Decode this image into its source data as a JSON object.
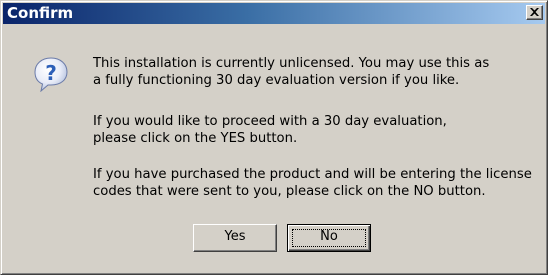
{
  "window": {
    "title": "Confirm",
    "close_symbol": "close-icon"
  },
  "icon": "question-icon",
  "message": {
    "paragraph1_line1": "This installation is currently unlicensed. You may use this as",
    "paragraph1_line2": "a fully functioning 30 day evaluation version if you like.",
    "paragraph2_line1": "If you would like to proceed with  a 30 day evaluation,",
    "paragraph2_line2": "please click on the YES button.",
    "paragraph3_line1": "If you have purchased the product and will be entering the license",
    "paragraph3_line2": "codes that were sent to you, please click on the NO button."
  },
  "buttons": {
    "yes_label": "Yes",
    "no_label": "No"
  },
  "colors": {
    "titlebar_start": "#0a246a",
    "titlebar_end": "#a6caf0",
    "face": "#d4d0c8",
    "icon_blue": "#2c5fb8"
  }
}
